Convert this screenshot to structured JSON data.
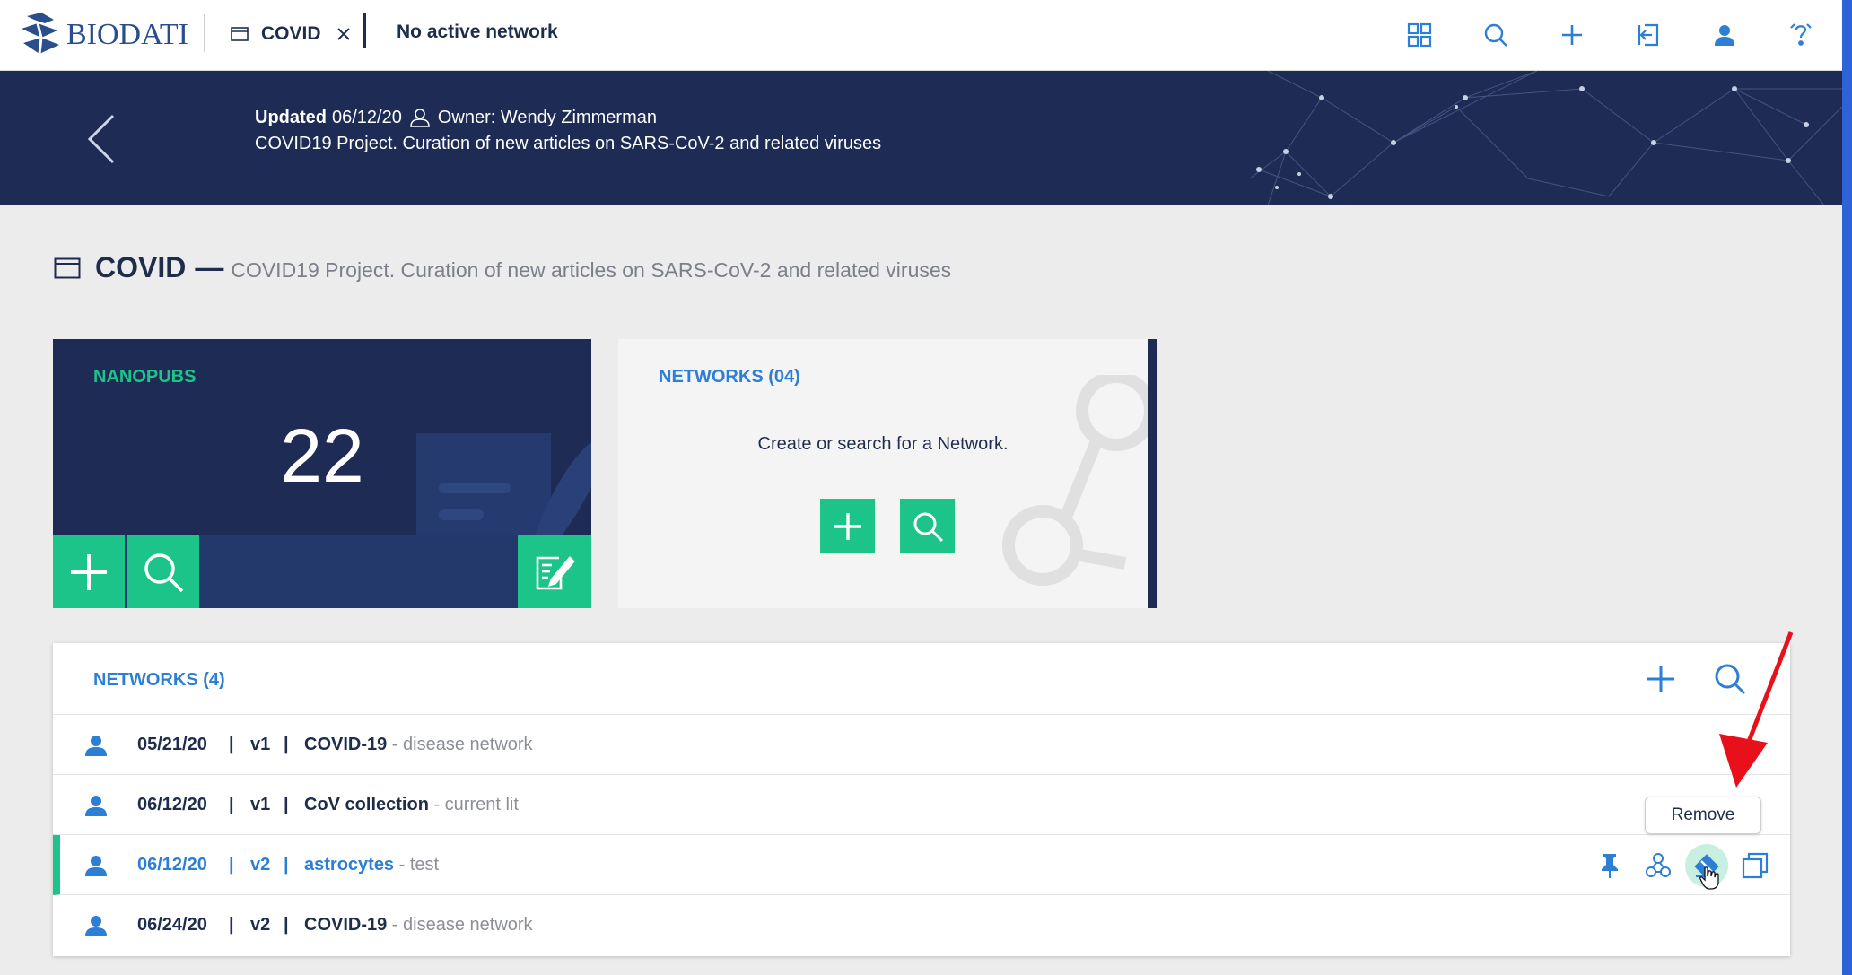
{
  "app": {
    "logo_text": "BIODATI"
  },
  "tab": {
    "label": "COVID",
    "network_status": "No active network"
  },
  "toolbar": {
    "icons": [
      "grid-icon",
      "search-icon",
      "plus-icon",
      "import-icon",
      "user-icon",
      "help-icon"
    ]
  },
  "banner": {
    "updated_label": "Updated",
    "updated_date": "06/12/20",
    "owner": "Owner: Wendy Zimmerman",
    "description": "COVID19 Project. Curation of new articles on SARS-CoV-2 and related viruses"
  },
  "page": {
    "title": "COVID",
    "dash": "—",
    "description": "COVID19 Project. Curation of new articles on SARS-CoV-2 and related viruses"
  },
  "nanopubs_card": {
    "label": "NANOPUBS",
    "count": "22"
  },
  "networks_card": {
    "label": "NETWORKS (04)",
    "hint": "Create or search for a Network."
  },
  "networks_list": {
    "title": "NETWORKS (4)",
    "rows": [
      {
        "date": "05/21/20",
        "version": "v1",
        "name": "COVID-19",
        "subtitle": " - disease network"
      },
      {
        "date": "06/12/20",
        "version": "v1",
        "name": "CoV collection",
        "subtitle": " - current lit"
      },
      {
        "date": "06/12/20",
        "version": "v2",
        "name": "astrocytes",
        "subtitle": " - test"
      },
      {
        "date": "06/24/20",
        "version": "v2",
        "name": "COVID-19",
        "subtitle": " - disease network"
      }
    ],
    "separator": "|"
  },
  "tooltip": {
    "text": "Remove"
  },
  "colors": {
    "navy": "#1d2b55",
    "green": "#1dc48a",
    "blue": "#2d7fd6",
    "red_arrow": "#e8101a"
  }
}
